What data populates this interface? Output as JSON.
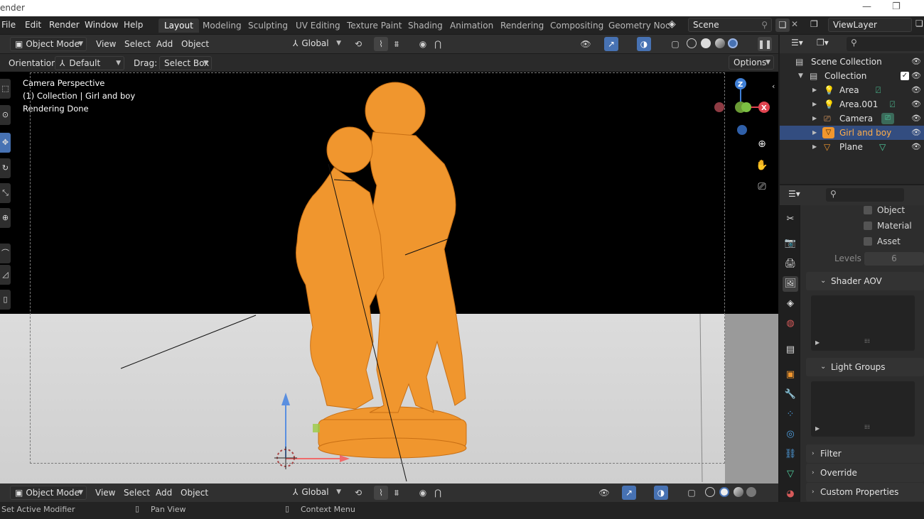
{
  "window": {
    "title": "ender"
  },
  "menubar": [
    "File",
    "Edit",
    "Render",
    "Window",
    "Help"
  ],
  "workspaces": [
    "Layout",
    "Modeling",
    "Sculpting",
    "UV Editing",
    "Texture Paint",
    "Shading",
    "Animation",
    "Rendering",
    "Compositing",
    "Geometry Noc"
  ],
  "active_workspace": "Layout",
  "scene": {
    "name": "Scene"
  },
  "view_layer": {
    "name": "ViewLayer"
  },
  "header": {
    "mode": "Object Mode",
    "menus": [
      "View",
      "Select",
      "Add",
      "Object"
    ],
    "orientation_global": "Global"
  },
  "tool_settings": {
    "orientation_label": "Orientation:",
    "orientation_value": "Default",
    "drag_label": "Drag:",
    "drag_value": "Select Box",
    "options_label": "Options"
  },
  "viewport_overlay": {
    "line1": "Camera Perspective",
    "line2": "(1) Collection | Girl and boy",
    "line3": "Rendering Done"
  },
  "gizmo": {
    "z": "Z",
    "x": "X"
  },
  "bottom_header": {
    "mode": "Object Mode",
    "menus": [
      "View",
      "Select",
      "Add",
      "Object"
    ],
    "orientation_global": "Global"
  },
  "status": {
    "left": "Set Active Modifier",
    "middle": "Pan View",
    "right": "Context Menu"
  },
  "outliner": {
    "root": "Scene Collection",
    "collection": "Collection",
    "items": [
      {
        "name": "Area",
        "icon": "light-icon",
        "selected": false
      },
      {
        "name": "Area.001",
        "icon": "light-icon",
        "selected": false
      },
      {
        "name": "Camera",
        "icon": "camera-icon",
        "selected": false
      },
      {
        "name": "Girl and boy",
        "icon": "mesh-icon",
        "selected": true
      },
      {
        "name": "Plane",
        "icon": "mesh-icon",
        "selected": false
      }
    ]
  },
  "properties": {
    "checkboxes": [
      "Object",
      "Material",
      "Asset"
    ],
    "levels_label": "Levels",
    "levels_value": "6",
    "panels": [
      "Shader AOV",
      "Light Groups",
      "Filter",
      "Override",
      "Custom Properties"
    ]
  },
  "colors": {
    "accent": "#4772b3",
    "selection": "#ffae4a",
    "statue": "#f0962e"
  }
}
